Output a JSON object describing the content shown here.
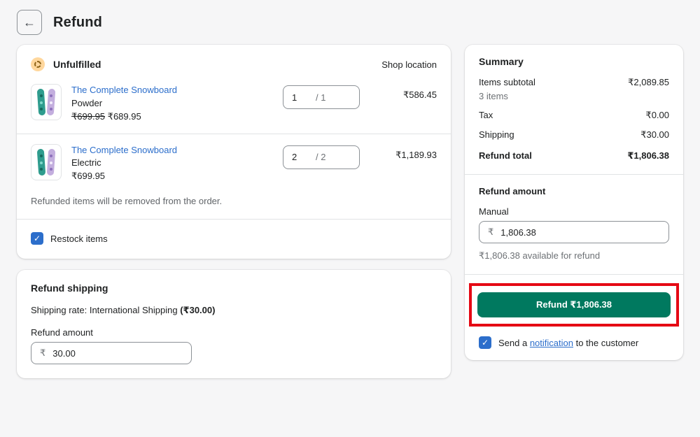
{
  "header": {
    "back_icon": "←",
    "title": "Refund"
  },
  "icons": {
    "check": "✓"
  },
  "colors": {
    "accent_green": "#00795f",
    "link_blue": "#2c6ecb",
    "checkbox_blue": "#2c6ecb",
    "status_badge_bg": "#ffd79d",
    "annotation_red": "#e50914",
    "page_bg": "#f6f6f7"
  },
  "fulfillment": {
    "status_label": "Unfulfilled",
    "location_label": "Shop location",
    "items": [
      {
        "title": "The Complete Snowboard",
        "variant": "Powder",
        "compare_price": "₹699.95",
        "price": "₹689.95",
        "qty": "1",
        "qty_total": "/ 1",
        "amount": "₹586.45"
      },
      {
        "title": "The Complete Snowboard",
        "variant": "Electric",
        "compare_price": "",
        "price": "₹699.95",
        "qty": "2",
        "qty_total": "/ 2",
        "amount": "₹1,189.93"
      }
    ],
    "note": "Refunded items will be removed from the order.",
    "restock_label": "Restock items"
  },
  "shipping_refund": {
    "title": "Refund shipping",
    "rate_prefix": "Shipping rate: International Shipping ",
    "rate_amount": "(₹30.00)",
    "amount_label": "Refund amount",
    "currency": "₹",
    "value": "30.00"
  },
  "summary": {
    "title": "Summary",
    "subtotal_label": "Items subtotal",
    "subtotal_value": "₹2,089.85",
    "subtotal_note": "3 items",
    "tax_label": "Tax",
    "tax_value": "₹0.00",
    "shipping_label": "Shipping",
    "shipping_value": "₹30.00",
    "total_label": "Refund total",
    "total_value": "₹1,806.38"
  },
  "refund_amount": {
    "heading": "Refund amount",
    "method_label": "Manual",
    "currency": "₹",
    "value": "1,806.38",
    "available_note": "₹1,806.38 available for refund"
  },
  "actions": {
    "refund_button": "Refund ₹1,806.38",
    "notify_prefix": "Send a ",
    "notify_link": "notification",
    "notify_suffix": " to the customer"
  }
}
